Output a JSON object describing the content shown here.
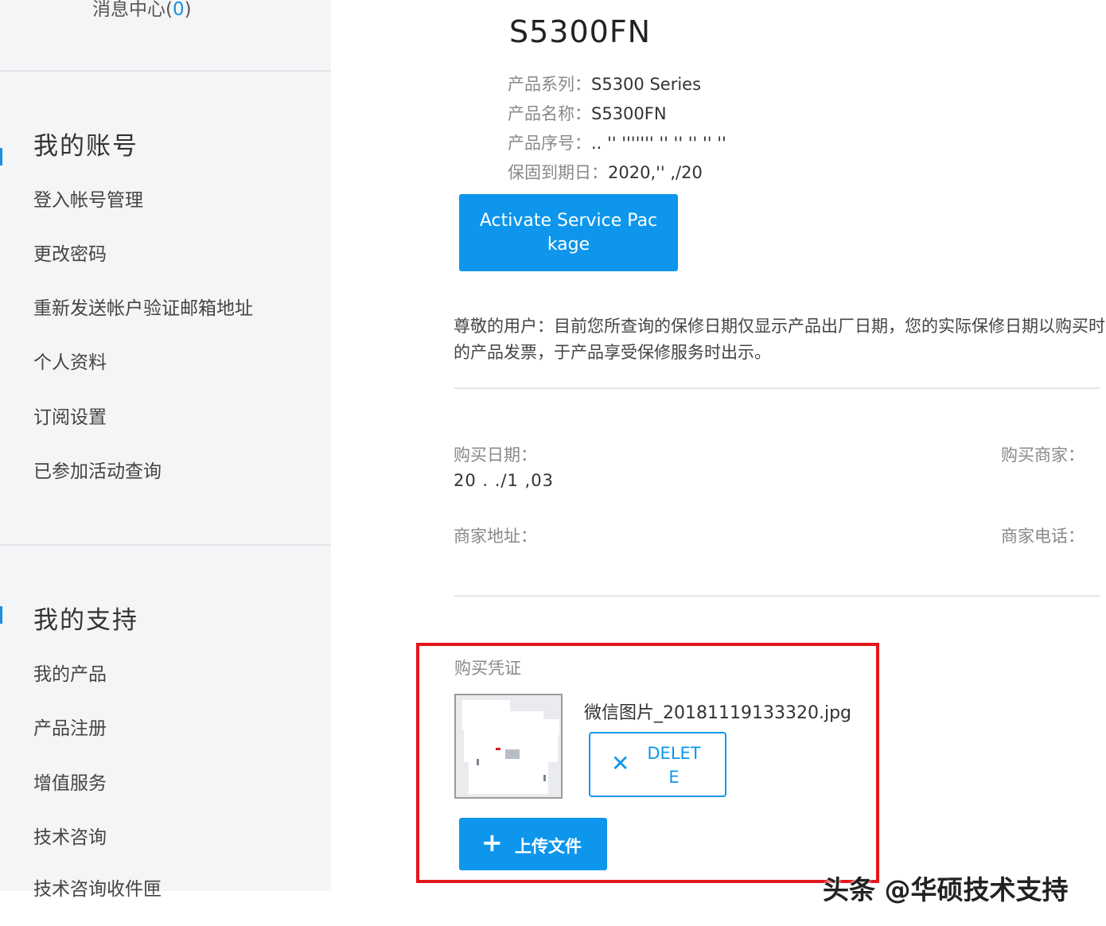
{
  "sidebar": {
    "message_center": {
      "label": "消息中心(",
      "count": "0",
      "suffix": ")"
    },
    "account_section": {
      "title": "我的账号",
      "items": [
        "登入帐号管理",
        "更改密码",
        "重新发送帐户验证邮箱地址",
        "个人资料",
        "订阅设置",
        "已参加活动查询"
      ]
    },
    "support_section": {
      "title": "我的支持",
      "items": [
        "我的产品",
        "产品注册",
        "增值服务",
        "技术咨询",
        "技术咨询收件匣"
      ]
    }
  },
  "product": {
    "model": "S5300FN",
    "specs": [
      {
        "label": "产品系列：",
        "value": "S5300 Series"
      },
      {
        "label": "产品名称：",
        "value": "S5300FN"
      },
      {
        "label": "产品序号：",
        "value": ".. '' ''''''' '' '' '' '' ''"
      },
      {
        "label": "保固到期日：",
        "value": "2020,'' ,/20"
      }
    ],
    "activate_button": "Activate Service Package",
    "notice": "尊敬的用户：目前您所查询的保修日期仅显示产品出厂日期，您的实际保修日期以购买时的产品发票，于产品享受保修服务时出示。"
  },
  "purchase": {
    "date_label": "购买日期：",
    "date_value": "20 . ./1 ,03",
    "merchant_label": "购买商家：",
    "address_label": "商家地址：",
    "phone_label": "商家电话："
  },
  "proof": {
    "label": "购买凭证",
    "filename": "微信图片_20181119133320.jpg",
    "delete_button": "DELETE",
    "upload_button": "上传文件"
  },
  "watermark": "头条 @华硕技术支持",
  "colors": {
    "accent": "#0d96ec",
    "highlight_border": "#e3151c",
    "sidebar_bg": "#f4f5f7"
  },
  "icons": {
    "delete": "close-icon",
    "upload": "plus-icon"
  }
}
